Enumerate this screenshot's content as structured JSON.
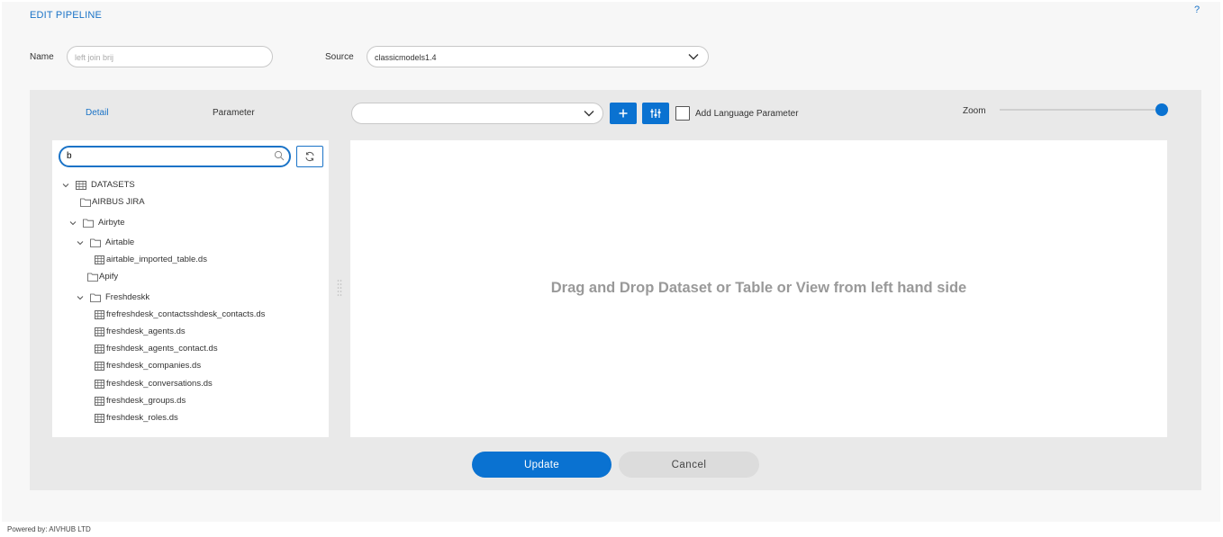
{
  "header": {
    "title": "EDIT PIPELINE",
    "help": "?"
  },
  "form": {
    "name_label": "Name",
    "name_value": "left join brij",
    "source_label": "Source",
    "source_value": "classicmodels1.4"
  },
  "tabs": {
    "detail": "Detail",
    "parameter": "Parameter"
  },
  "toolbar": {
    "select_value": "",
    "add_icon": "plus-icon",
    "settings_icon": "sliders-icon",
    "add_language_label": "Add Language Parameter",
    "add_language_checked": false,
    "zoom_label": "Zoom",
    "zoom_level": 1.0
  },
  "tree": {
    "search_value": "b",
    "items": [
      {
        "label": "DATASETS",
        "type": "root",
        "expanded": true
      },
      {
        "label": "AIRBUS JIRA",
        "type": "folder"
      },
      {
        "label": "Airbyte",
        "type": "folder",
        "expanded": true
      },
      {
        "label": "Airtable",
        "type": "folder",
        "expanded": true
      },
      {
        "label": "airtable_imported_table.ds",
        "type": "dataset"
      },
      {
        "label": "Apify",
        "type": "folder"
      },
      {
        "label": "Freshdeskk",
        "type": "folder",
        "expanded": true
      },
      {
        "label": "frefreshdesk_contactsshdesk_contacts.ds",
        "type": "dataset"
      },
      {
        "label": "freshdesk_agents.ds",
        "type": "dataset"
      },
      {
        "label": "freshdesk_agents_contact.ds",
        "type": "dataset"
      },
      {
        "label": "freshdesk_companies.ds",
        "type": "dataset"
      },
      {
        "label": "freshdesk_conversations.ds",
        "type": "dataset"
      },
      {
        "label": "freshdesk_groups.ds",
        "type": "dataset"
      },
      {
        "label": "freshdesk_roles.ds",
        "type": "dataset"
      }
    ]
  },
  "canvas": {
    "message": "Drag and Drop Dataset or Table or View from left hand side"
  },
  "actions": {
    "update": "Update",
    "cancel": "Cancel"
  },
  "footer": {
    "text": "Powered by: AIVHUB LTD"
  },
  "colors": {
    "accent": "#0a72d1",
    "panel": "#e9e9e9"
  }
}
